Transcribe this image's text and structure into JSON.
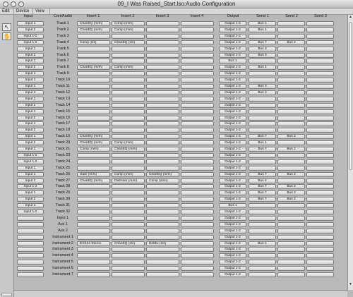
{
  "window": {
    "title": "09_I Was Raised_Start.lso:Audio Configuration"
  },
  "menus": [
    "Edit",
    "Device",
    "View"
  ],
  "tools": [
    {
      "name": "pointer",
      "glyph": "↖"
    },
    {
      "name": "hand",
      "glyph": "✋"
    }
  ],
  "headers": [
    "Input",
    "CoreAudio",
    "Insert 1",
    "Insert 2",
    "Insert 3",
    "Insert 4",
    "Output",
    "Send 1",
    "Send 2",
    "Send 3"
  ],
  "rows": [
    {
      "input": "Input 1",
      "label": "Track 1",
      "inserts": [
        "ChanEQ (m/m)",
        "Comp (m/m)",
        "",
        ""
      ],
      "output": "Output 1-2",
      "sends": [
        "Bus 1",
        "",
        ""
      ]
    },
    {
      "input": "Input 2",
      "label": "Track 2",
      "inserts": [
        "ChanEQ (m/m)",
        "Comp (m/m)",
        "",
        ""
      ],
      "output": "Output 1-2",
      "sends": [
        "Bus 1",
        "",
        ""
      ]
    },
    {
      "input": "Input 1-2",
      "label": "Track 3",
      "inserts": [
        "",
        "",
        "",
        ""
      ],
      "output": "Output 1-2",
      "sends": [
        "",
        "",
        ""
      ]
    },
    {
      "input": "Input 1-2",
      "label": "Track 4",
      "inserts": [
        "Comp (s/s)",
        "ChanEQ (s/s)",
        "",
        ""
      ],
      "output": "Output 1-2",
      "sends": [
        "Bus 7",
        "Bus 2",
        ""
      ]
    },
    {
      "input": "Input 1",
      "label": "Track 5",
      "inserts": [
        "",
        "",
        "",
        ""
      ],
      "output": "Output 1-2",
      "sends": [
        "Bus 3",
        "",
        ""
      ]
    },
    {
      "input": "Input 2",
      "label": "Track 6",
      "inserts": [
        "",
        "",
        "",
        ""
      ],
      "output": "Output 1-2",
      "sends": [
        "Bus 3",
        "",
        ""
      ]
    },
    {
      "input": "Input 1",
      "label": "Track 7",
      "inserts": [
        "",
        "",
        "",
        ""
      ],
      "output": "Bus 1",
      "sends": [
        "",
        "",
        ""
      ]
    },
    {
      "input": "Input 2",
      "label": "Track 8",
      "inserts": [
        "ChanEQ (m/m)",
        "Comp (m/m)",
        "",
        ""
      ],
      "output": "Output 1-2",
      "sends": [
        "Bus 1",
        "",
        ""
      ]
    },
    {
      "input": "Input 1",
      "label": "Track 9",
      "inserts": [
        "",
        "",
        "",
        ""
      ],
      "output": "Output 1-2",
      "sends": [
        "",
        "",
        ""
      ]
    },
    {
      "input": "Input 1",
      "label": "Track 10",
      "inserts": [
        "",
        "",
        "",
        ""
      ],
      "output": "Output 1-2",
      "sends": [
        "",
        "",
        ""
      ]
    },
    {
      "input": "Input 1",
      "label": "Track 11",
      "inserts": [
        "",
        "",
        "",
        ""
      ],
      "output": "Output 1-2",
      "sends": [
        "Bus 3",
        "",
        ""
      ]
    },
    {
      "input": "Input 1",
      "label": "Track 12",
      "inserts": [
        "",
        "",
        "",
        ""
      ],
      "output": "Output 1-2",
      "sends": [
        "Bus 3",
        "",
        ""
      ]
    },
    {
      "input": "Input 1",
      "label": "Track 13",
      "inserts": [
        "",
        "",
        "",
        ""
      ],
      "output": "Output 1-2",
      "sends": [
        "",
        "",
        ""
      ]
    },
    {
      "input": "Input 2",
      "label": "Track 14",
      "inserts": [
        "",
        "",
        "",
        ""
      ],
      "output": "Output 1-2",
      "sends": [
        "",
        "",
        ""
      ]
    },
    {
      "input": "Input 1",
      "label": "Track 15",
      "inserts": [
        "",
        "",
        "",
        ""
      ],
      "output": "Output 1-2",
      "sends": [
        "",
        "",
        ""
      ]
    },
    {
      "input": "Input 2",
      "label": "Track 16",
      "inserts": [
        "",
        "",
        "",
        ""
      ],
      "output": "Output 1-2",
      "sends": [
        "",
        "",
        ""
      ]
    },
    {
      "input": "Input 1",
      "label": "Track 17",
      "inserts": [
        "",
        "",
        "",
        ""
      ],
      "output": "Output 1-2",
      "sends": [
        "",
        "",
        ""
      ]
    },
    {
      "input": "Input 2",
      "label": "Track 18",
      "inserts": [
        "",
        "",
        "",
        ""
      ],
      "output": "Output 1-2",
      "sends": [
        "",
        "",
        ""
      ]
    },
    {
      "input": "Input 1",
      "label": "Track 19",
      "inserts": [
        "ChanEQ (m/m)",
        "",
        "",
        ""
      ],
      "output": "Output 1-2",
      "sends": [
        "Bus 7",
        "Bus 2",
        ""
      ]
    },
    {
      "input": "Input 2",
      "label": "Track 20",
      "inserts": [
        "ChanEQ (m/m)",
        "Comp (m/m)",
        "",
        ""
      ],
      "output": "Output 1-2",
      "sends": [
        "Bus 1",
        "",
        ""
      ]
    },
    {
      "input": "Input 1",
      "label": "Track 21",
      "inserts": [
        "Comp (m/m)",
        "ChanEQ (m/m)",
        "",
        ""
      ],
      "output": "Output 1-2",
      "sends": [
        "Bus 7",
        "Bus 2",
        ""
      ]
    },
    {
      "input": "Input 1-2",
      "label": "Track 23",
      "inserts": [
        "",
        "",
        "",
        ""
      ],
      "output": "Output 1-2",
      "sends": [
        "",
        "",
        ""
      ]
    },
    {
      "input": "Input 1-2",
      "label": "Track 24",
      "inserts": [
        "",
        "",
        "",
        ""
      ],
      "output": "Output 1-2",
      "sends": [
        "",
        "",
        ""
      ]
    },
    {
      "input": "Input 1",
      "label": "Track 25",
      "inserts": [
        "",
        "",
        "",
        ""
      ],
      "output": "Output 1-2",
      "sends": [
        "",
        "",
        ""
      ]
    },
    {
      "input": "Input 1",
      "label": "Track 26",
      "inserts": [
        "Gate (m/m)",
        "Comp (m/m)",
        "ChanEQ (m/m)",
        ""
      ],
      "output": "Output 1-2",
      "sends": [
        "Bus 7",
        "Bus 2",
        ""
      ]
    },
    {
      "input": "Input 2",
      "label": "Track 27",
      "inserts": [
        "ChanEQ (m/m)",
        "DeEsser (m/m)",
        "Comp (m/m)",
        ""
      ],
      "output": "Output 1-2",
      "sends": [
        "Bus 4",
        "",
        ""
      ]
    },
    {
      "input": "Input 1-2",
      "label": "Track 28",
      "inserts": [
        "",
        "",
        "",
        ""
      ],
      "output": "Output 1-2",
      "sends": [
        "Bus 7",
        "Bus 2",
        ""
      ]
    },
    {
      "input": "Input 1",
      "label": "Track 29",
      "inserts": [
        "",
        "",
        "",
        ""
      ],
      "output": "Output 1-2",
      "sends": [
        "Bus 7",
        "Bus 2",
        ""
      ]
    },
    {
      "input": "Input 2",
      "label": "Track 30",
      "inserts": [
        "",
        "",
        "",
        ""
      ],
      "output": "Output 1-2",
      "sends": [
        "Bus 7",
        "Bus 2",
        ""
      ]
    },
    {
      "input": "Input 1",
      "label": "Track 31",
      "inserts": [
        "",
        "",
        "",
        ""
      ],
      "output": "Bus 1",
      "sends": [
        "",
        "",
        ""
      ]
    },
    {
      "input": "Input 1-2",
      "label": "Track 32",
      "inserts": [
        "",
        "",
        "",
        ""
      ],
      "output": "Output 1-2",
      "sends": [
        "",
        "",
        ""
      ]
    },
    {
      "input": "",
      "label": "Input 1",
      "inserts": [
        "",
        "",
        "",
        ""
      ],
      "output": "Output 1-2",
      "sends": [
        "",
        "",
        ""
      ]
    },
    {
      "input": "",
      "label": "Aux 1",
      "inserts": [
        "",
        "",
        "",
        ""
      ],
      "output": "Output 1-2",
      "sends": [
        "",
        "",
        ""
      ]
    },
    {
      "input": "",
      "label": "Aux 2",
      "inserts": [
        "",
        "",
        "",
        ""
      ],
      "output": "Output 1-2",
      "sends": [
        "",
        "",
        ""
      ]
    },
    {
      "input": "",
      "label": "Instrument 1",
      "inserts": [
        "",
        "",
        "",
        ""
      ],
      "output": "Output 1-2",
      "sends": [
        "",
        "",
        ""
      ]
    },
    {
      "input": "",
      "label": "Instrument 2",
      "inserts": [
        "EXS24 Stereo",
        "ChanEQ (s/s)",
        "DirMix (s/s)",
        ""
      ],
      "output": "Output 1-2",
      "sends": [
        "Bus 1",
        "",
        ""
      ]
    },
    {
      "input": "",
      "label": "Instrument 3",
      "inserts": [
        "",
        "",
        "",
        ""
      ],
      "output": "Output 1-2",
      "sends": [
        "",
        "",
        ""
      ]
    },
    {
      "input": "",
      "label": "Instrument 4",
      "inserts": [
        "",
        "",
        "",
        ""
      ],
      "output": "Output 1-2",
      "sends": [
        "",
        "",
        ""
      ]
    },
    {
      "input": "",
      "label": "Instrument 5",
      "inserts": [
        "",
        "",
        "",
        ""
      ],
      "output": "Output 1-2",
      "sends": [
        "",
        "",
        ""
      ]
    },
    {
      "input": "",
      "label": "Instrument 6",
      "inserts": [
        "",
        "",
        "",
        ""
      ],
      "output": "Output 1-2",
      "sends": [
        "",
        "",
        ""
      ]
    },
    {
      "input": "",
      "label": "Instrument 7",
      "inserts": [
        "",
        "",
        "",
        ""
      ],
      "output": "Output 1-2",
      "sends": [
        "",
        "",
        ""
      ]
    }
  ]
}
